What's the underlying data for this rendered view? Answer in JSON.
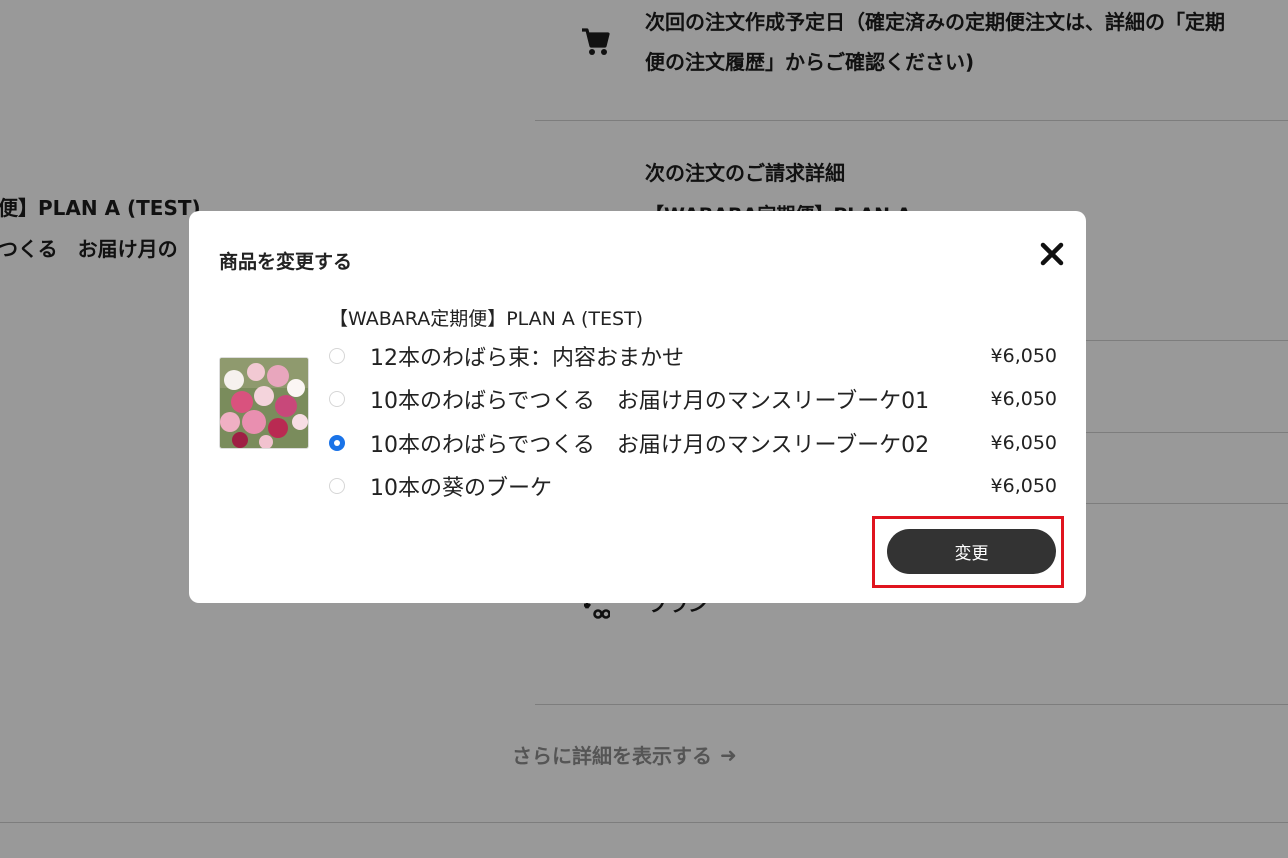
{
  "background": {
    "next_order_text_line1": "次回の注文作成予定日（確定済みの定期便注文は、詳細の「定期",
    "next_order_text_line2": "便の注文履歴」からご確認ください)",
    "billing_heading": "次の注文のご請求詳細",
    "billing_partial": "【WABARA定期便】PLAN A",
    "left_product_line1": "便】PLAN A (TEST)",
    "left_product_line2": "つくる　お届け月の",
    "plan_partial": "プラン",
    "more_details_link": "さらに詳細を表示する",
    "more_details_arrow": "➜"
  },
  "modal": {
    "title": "商品を変更する",
    "close_icon": "close-icon",
    "product_name": "【WABARA定期便】PLAN A (TEST)",
    "options": [
      {
        "label": "12本のわばら束：内容おまかせ",
        "price": "¥6,050",
        "selected": false
      },
      {
        "label": "10本のわばらでつくる　お届け月のマンスリーブーケ01",
        "price": "¥6,050",
        "selected": false
      },
      {
        "label": "10本のわばらでつくる　お届け月のマンスリーブーケ02",
        "price": "¥6,050",
        "selected": true
      },
      {
        "label": "10本の葵のブーケ",
        "price": "¥6,050",
        "selected": false
      }
    ],
    "change_button": "変更",
    "accent_color": "#1a73e8",
    "highlight_color": "#e0141e"
  }
}
